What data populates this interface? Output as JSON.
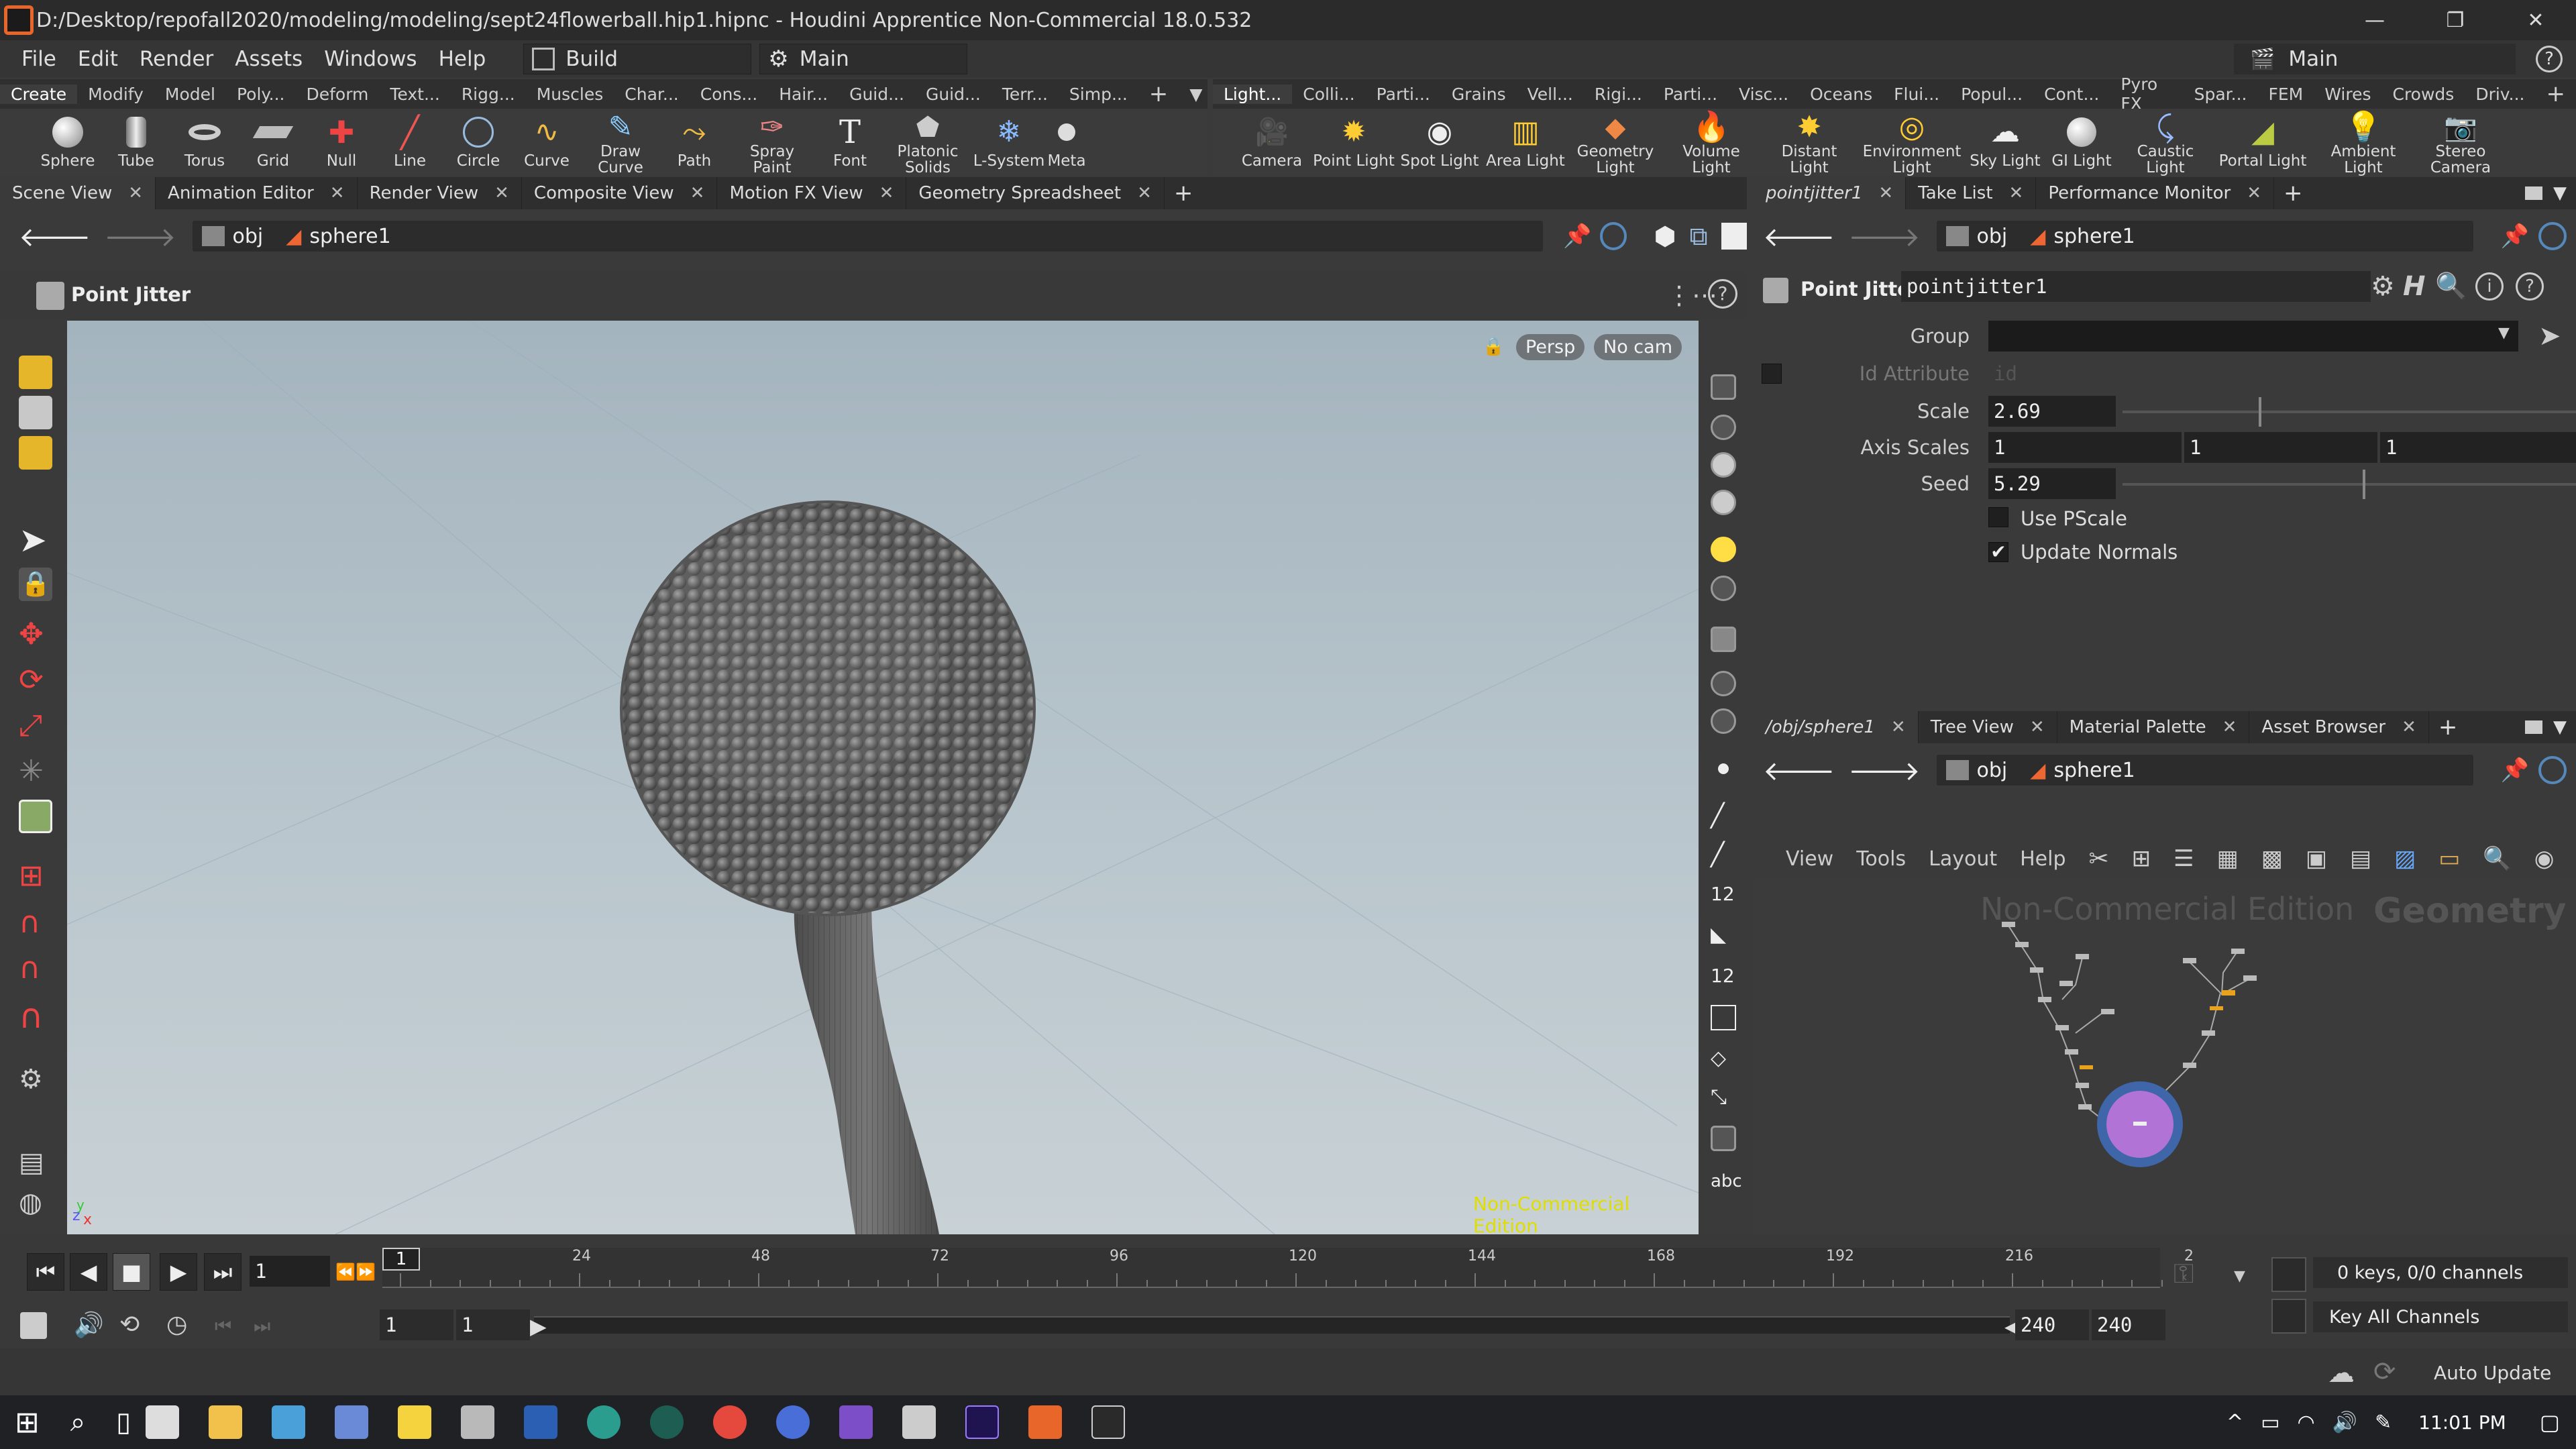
{
  "window": {
    "title": "D:/Desktop/repofall2020/modeling/modeling/sept24flowerball.hip1.hipnc - Houdini Apprentice Non-Commercial 18.0.532",
    "minimize": "—",
    "restore": "❐",
    "close": "✕"
  },
  "menu": {
    "items": [
      "File",
      "Edit",
      "Render",
      "Assets",
      "Windows",
      "Help"
    ],
    "desktop": "Build",
    "desktop2": "Main",
    "right_desktop": "Main"
  },
  "shelf_left": {
    "tabs": [
      "Create",
      "Modify",
      "Model",
      "Poly...",
      "Deform",
      "Text...",
      "Rigg...",
      "Muscles",
      "Char...",
      "Cons...",
      "Hair...",
      "Guid...",
      "Guid...",
      "Terr...",
      "Simp..."
    ],
    "tools": [
      "Sphere",
      "Tube",
      "Torus",
      "Grid",
      "Null",
      "Line",
      "Circle",
      "Curve",
      "Draw Curve",
      "Path",
      "Spray Paint",
      "Font",
      "Platonic Solids",
      "L-System",
      "Meta"
    ]
  },
  "shelf_right": {
    "tabs": [
      "Light...",
      "Colli...",
      "Parti...",
      "Grains",
      "Vell...",
      "Rigi...",
      "Parti...",
      "Visc...",
      "Oceans",
      "Flui...",
      "Popul...",
      "Cont...",
      "Pyro FX",
      "Spar...",
      "FEM",
      "Wires",
      "Crowds",
      "Driv..."
    ],
    "tools": [
      "Camera",
      "Point Light",
      "Spot Light",
      "Area Light",
      "Geometry Light",
      "Volume Light",
      "Distant Light",
      "Environment Light",
      "Sky Light",
      "GI Light",
      "Caustic Light",
      "Portal Light",
      "Ambient Light",
      "Stereo Camera"
    ]
  },
  "left_tabs": [
    "Scene View",
    "Animation Editor",
    "Render View",
    "Composite View",
    "Motion FX View",
    "Geometry Spreadsheet"
  ],
  "right_top_tabs": [
    "pointjitter1",
    "Take List",
    "Performance Monitor"
  ],
  "right_bottom_tabs": [
    "/obj/sphere1",
    "Tree View",
    "Material Palette",
    "Asset Browser"
  ],
  "path": {
    "obj": "obj",
    "node": "sphere1"
  },
  "viewer": {
    "op_label": "Point Jitter",
    "persp": "Persp",
    "nocam": "No cam",
    "watermark": "Non-Commercial Edition",
    "axis_z": "z",
    "axis_x": "x",
    "axis_y": "y"
  },
  "params": {
    "type": "Point Jitter",
    "name": "pointjitter1",
    "group_label": "Group",
    "group_value": "",
    "id_label": "Id Attribute",
    "id_value": "id",
    "scale_label": "Scale",
    "scale_value": "2.69",
    "scale_frac": 0.3,
    "axis_label": "Axis Scales",
    "axis": [
      "1",
      "1",
      "1"
    ],
    "seed_label": "Seed",
    "seed_value": "5.29",
    "seed_frac": 0.53,
    "use_pscale": "Use PScale",
    "update_normals": "Update Normals",
    "use_pscale_checked": false,
    "update_normals_checked": true
  },
  "network": {
    "menus": [
      "View",
      "Tools",
      "Layout",
      "Help"
    ],
    "watermark": "Non-Commercial Edition",
    "context": "Geometry"
  },
  "timeline": {
    "frame": "1",
    "ticks": [
      "1",
      "24",
      "48",
      "72",
      "96",
      "120",
      "144",
      "168",
      "192",
      "216",
      "2"
    ],
    "start": "1",
    "start2": "1",
    "end": "240",
    "end2": "240",
    "keys": "0 keys, 0/0 channels",
    "key_all": "Key All Channels",
    "auto_update": "Auto Update"
  },
  "taskbar": {
    "time": "11:01 PM"
  },
  "colors": {
    "accent": "#e8a21b",
    "selected_node": "#b173d6",
    "watermark": "#dede00"
  }
}
